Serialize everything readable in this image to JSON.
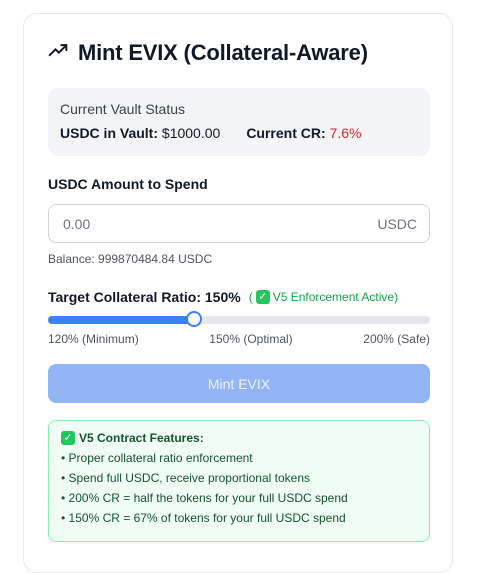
{
  "header": {
    "title": "Mint EVIX (Collateral-Aware)",
    "icon": "trending-up-icon"
  },
  "vault_status": {
    "title": "Current Vault Status",
    "usdc_label": "USDC in Vault:",
    "usdc_value": "$1000.00",
    "cr_label": "Current CR:",
    "cr_value": "7.6%",
    "cr_color": "#dc2626"
  },
  "amount": {
    "label": "USDC Amount to Spend",
    "placeholder": "0.00",
    "value": "",
    "unit": "USDC",
    "balance": "Balance: 999870484.84 USDC"
  },
  "ratio": {
    "label": "Target Collateral Ratio: 150%",
    "enforcement": "V5 Enforcement Active)",
    "enforcement_prefix": "(",
    "min": 120,
    "max": 200,
    "value": 150,
    "ticks": [
      "120% (Minimum)",
      "150% (Optimal)",
      "200% (Safe)"
    ],
    "accent": "#3b82f6"
  },
  "mint_button": {
    "label": "Mint EVIX",
    "disabled": true
  },
  "features": {
    "title": "V5 Contract Features:",
    "items": [
      "Proper collateral ratio enforcement",
      "Spend full USDC, receive proportional tokens",
      "200% CR = half the tokens for your full USDC spend",
      "150% CR = 67% of tokens for your full USDC spend"
    ]
  }
}
